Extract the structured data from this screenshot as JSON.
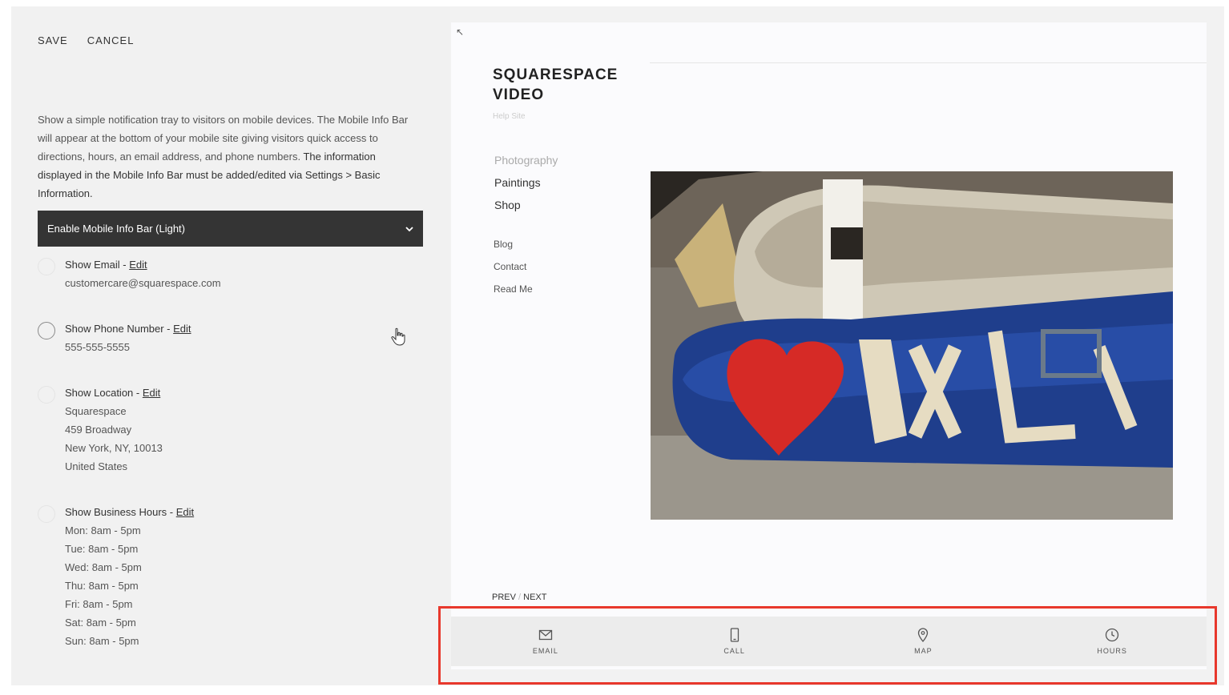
{
  "toolbar": {
    "save_label": "SAVE",
    "cancel_label": "CANCEL"
  },
  "description": {
    "line1": "Show a simple notification tray to visitors on mobile devices. The Mobile Info Bar will appear at the bottom of your mobile site giving visitors quick access to directions, hours, an email address, and phone numbers.",
    "line2": "The information displayed in the Mobile Info Bar must be added/edited via Settings > Basic Information."
  },
  "dropdown": {
    "selected": "Enable Mobile Info Bar (Light)"
  },
  "options": {
    "email": {
      "title": "Show Email - ",
      "edit": "Edit",
      "value": "customercare@squarespace.com"
    },
    "phone": {
      "title": "Show Phone Number - ",
      "edit": "Edit",
      "value": "555-555-5555"
    },
    "location": {
      "title": "Show Location - ",
      "edit": "Edit",
      "lines": [
        "Squarespace",
        "459 Broadway",
        "New York, NY, 10013",
        "United States"
      ]
    },
    "hours": {
      "title": "Show Business Hours - ",
      "edit": "Edit",
      "lines": [
        "Mon: 8am - 5pm",
        "Tue: 8am - 5pm",
        "Wed: 8am - 5pm",
        "Thu: 8am - 5pm",
        "Fri: 8am - 5pm",
        "Sat: 8am - 5pm",
        "Sun: 8am - 5pm"
      ]
    }
  },
  "preview": {
    "corner_arrow": "↖",
    "site_title_line1": "SQUARESPACE",
    "site_title_line2": "VIDEO",
    "site_subtitle": "Help Site",
    "nav_primary": [
      "Photography",
      "Paintings",
      "Shop"
    ],
    "nav_secondary": [
      "Blog",
      "Contact",
      "Read Me"
    ],
    "prev": "PREV",
    "sep": "/",
    "next": "NEXT"
  },
  "infobar": {
    "items": [
      {
        "label": "EMAIL",
        "icon": "mail-icon"
      },
      {
        "label": "CALL",
        "icon": "phone-icon"
      },
      {
        "label": "MAP",
        "icon": "map-pin-icon"
      },
      {
        "label": "HOURS",
        "icon": "clock-icon"
      }
    ]
  },
  "colors": {
    "dropdown_bg": "#343434",
    "highlight": "#e8382c"
  }
}
